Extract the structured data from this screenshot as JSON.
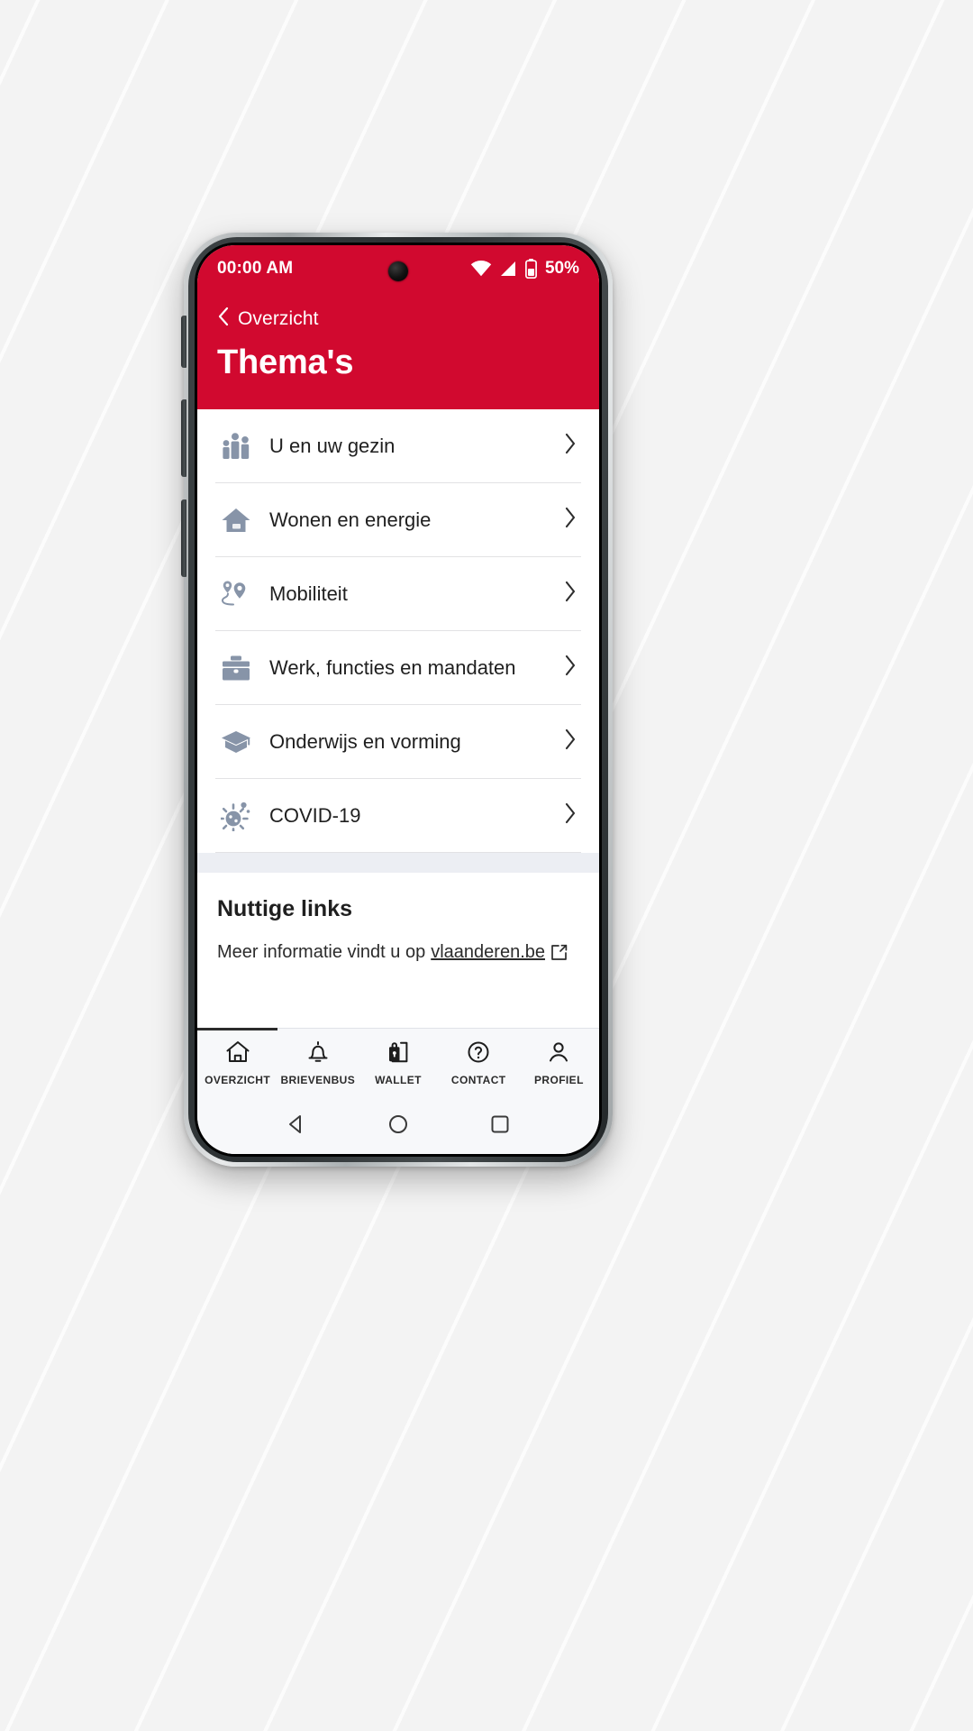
{
  "statusbar": {
    "clock": "00:00 AM",
    "battery_percent": "50%",
    "icons": [
      "wifi-icon",
      "cellular-signal-icon",
      "battery-icon"
    ]
  },
  "header": {
    "back_label": "Overzicht",
    "back_icon": "chevron-left-icon",
    "title": "Thema's",
    "background_color": "#d1092f"
  },
  "themes": {
    "items": [
      {
        "label": "U en uw gezin",
        "icon": "family-icon"
      },
      {
        "label": "Wonen en energie",
        "icon": "house-icon"
      },
      {
        "label": "Mobiliteit",
        "icon": "map-pin-route-icon"
      },
      {
        "label": "Werk, functies en mandaten",
        "icon": "briefcase-icon"
      },
      {
        "label": "Onderwijs en vorming",
        "icon": "graduation-cap-icon"
      },
      {
        "label": "COVID-19",
        "icon": "virus-icon"
      }
    ]
  },
  "links": {
    "title": "Nuttige links",
    "text_before": "Meer informatie vindt u op",
    "link_label": "vlaanderen.be",
    "link_icon": "external-link-icon"
  },
  "tabbar": {
    "active_index": 0,
    "tabs": [
      {
        "label": "OVERZICHT",
        "icon": "home-icon"
      },
      {
        "label": "BRIEVENBUS",
        "icon": "bell-icon"
      },
      {
        "label": "WALLET",
        "icon": "wallet-lock-icon"
      },
      {
        "label": "CONTACT",
        "icon": "question-circle-icon"
      },
      {
        "label": "PROFIEL",
        "icon": "person-icon"
      }
    ]
  },
  "androidnav": {
    "buttons": [
      "back-triangle-icon",
      "home-circle-icon",
      "recents-square-icon"
    ]
  },
  "colors": {
    "brand_red": "#d1092f",
    "icon_gray_blue": "#8794a8",
    "divider": "#e2e2e4",
    "section_gap": "#eceef3"
  }
}
